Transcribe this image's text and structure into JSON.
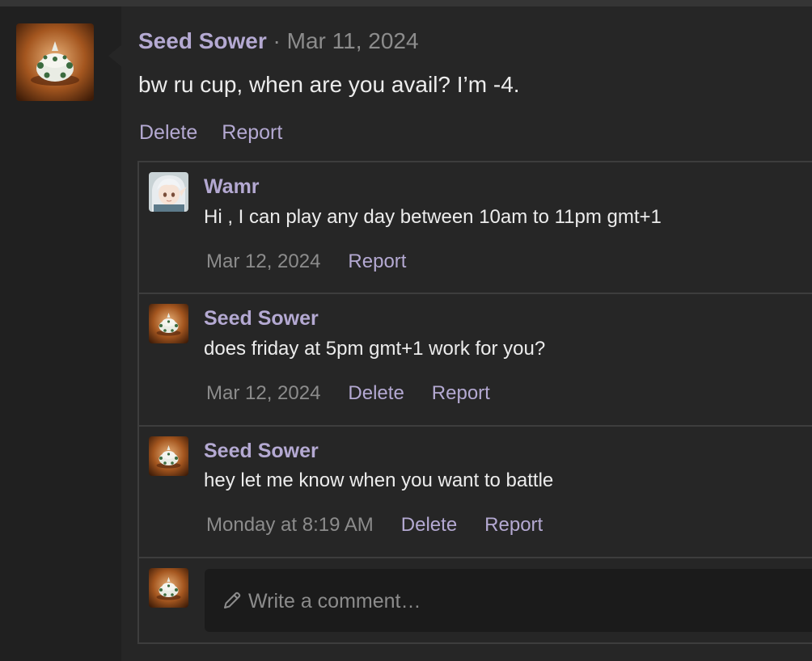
{
  "post": {
    "author": "Seed Sower",
    "separator": "·",
    "date": "Mar 11, 2024",
    "body": "bw ru cup, when are you avail? I’m -4.",
    "delete_label": "Delete",
    "report_label": "Report",
    "avatar_icon": "spiky-pokemon-avatar-icon"
  },
  "comments": [
    {
      "author": "Wamr",
      "text": "Hi , I can play any day between 10am to 11pm gmt+1",
      "date": "Mar 12, 2024",
      "report_label": "Report",
      "avatar_icon": "anime-girl-avatar-icon"
    },
    {
      "author": "Seed Sower",
      "text": "does friday at 5pm gmt+1 work for you?",
      "date": "Mar 12, 2024",
      "delete_label": "Delete",
      "report_label": "Report",
      "avatar_icon": "spiky-pokemon-avatar-icon"
    },
    {
      "author": "Seed Sower",
      "text": "hey let me know when you want to battle",
      "date": "Monday at 8:19 AM",
      "delete_label": "Delete",
      "report_label": "Report",
      "avatar_icon": "spiky-pokemon-avatar-icon"
    }
  ],
  "reply": {
    "placeholder": "Write a comment…",
    "icon": "pencil-icon",
    "avatar_icon": "spiky-pokemon-avatar-icon"
  },
  "colors": {
    "accent": "#b4a9d2",
    "muted": "#8c8c8c",
    "text": "#ececec",
    "panel": "#262626",
    "rail": "#202020",
    "input": "#1b1b1b"
  }
}
